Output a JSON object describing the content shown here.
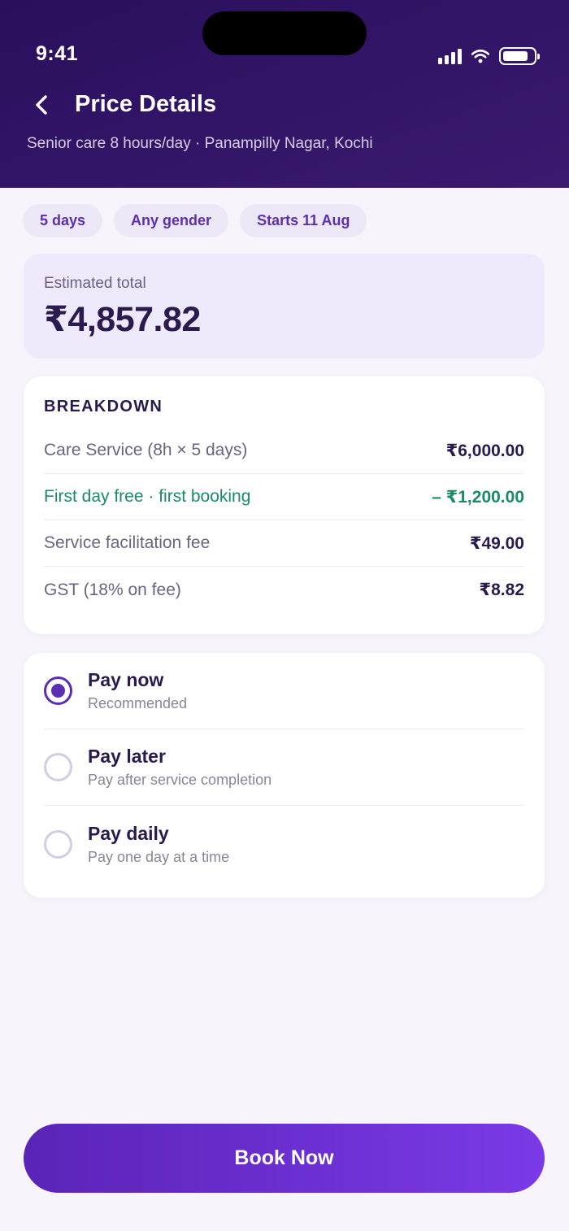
{
  "status_bar": {
    "time": "9:41"
  },
  "header": {
    "title": "Price Details",
    "subtitle": "Senior care 8 hours/day · Panampilly Nagar, Kochi"
  },
  "chips": [
    "5 days",
    "Any gender",
    "Starts 11 Aug"
  ],
  "estimate": {
    "label": "Estimated total",
    "value": "₹4,857.82"
  },
  "breakdown": {
    "title": "BREAKDOWN",
    "rows": [
      {
        "label": "Care Service (8h × 5 days)",
        "amount": "₹6,000.00"
      },
      {
        "label": "First day free · first booking",
        "amount": "– ₹1,200.00"
      },
      {
        "label": "Service facilitation fee",
        "amount": "₹49.00"
      },
      {
        "label": "GST (18% on fee)",
        "amount": "₹8.82"
      }
    ]
  },
  "payment_options": [
    {
      "title": "Pay now",
      "subtitle": "Recommended",
      "selected": true
    },
    {
      "title": "Pay later",
      "subtitle": "Pay after service completion",
      "selected": false
    },
    {
      "title": "Pay daily",
      "subtitle": "Pay one day at a time",
      "selected": false
    }
  ],
  "cta": {
    "label": "Book Now"
  },
  "colors": {
    "header": "#2a0f5e",
    "accent": "#5b2fb0",
    "discount": "#1a8a6a",
    "button_start": "#5a24b8",
    "button_end": "#7a3ae6"
  }
}
